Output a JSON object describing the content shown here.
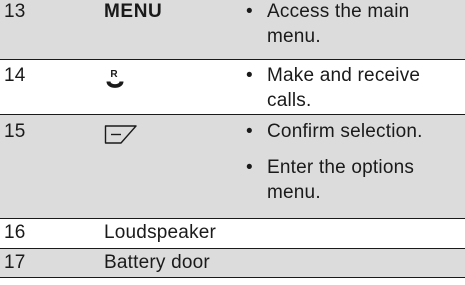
{
  "rows": [
    {
      "number": "13",
      "key": "MENU",
      "descriptions": [
        "Access the main menu."
      ],
      "shaded": true
    },
    {
      "number": "14",
      "key_icon": "call-button-icon",
      "key_icon_label": "R",
      "descriptions": [
        "Make and receive calls."
      ],
      "shaded": false
    },
    {
      "number": "15",
      "key_icon": "ok-softkey-icon",
      "descriptions": [
        "Confirm selection.",
        "Enter the options menu."
      ],
      "shaded": true
    },
    {
      "number": "16",
      "key": "Loudspeaker",
      "shaded": false
    },
    {
      "number": "17",
      "key": "Battery door",
      "shaded": true
    }
  ],
  "bullet_glyph": "•",
  "colors": {
    "shade": "#dcdcdc",
    "text": "#1a1a1a",
    "line": "#1a1a1a"
  }
}
